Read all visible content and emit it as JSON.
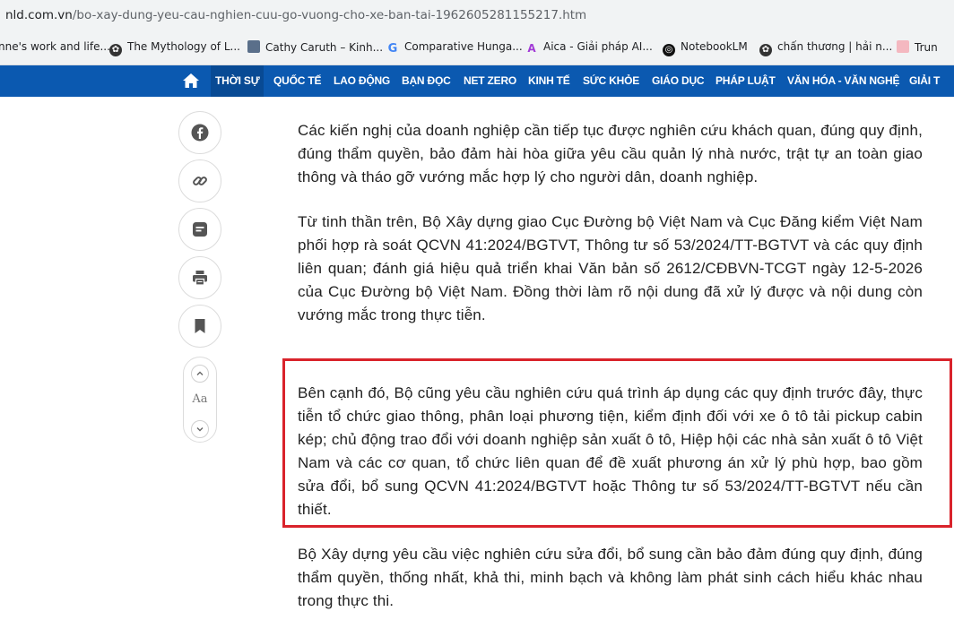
{
  "browser": {
    "url_host": "nld.com.vn",
    "url_path": "/bo-xay-dung-yeu-cau-nghien-cuu-go-vuong-cho-xe-ban-tai-196260528115521​7.htm",
    "bookmarks": [
      {
        "label": "nne's work and life...",
        "icon": "none"
      },
      {
        "label": "The Mythology of L...",
        "icon": "gear-icon"
      },
      {
        "label": "Cathy Caruth – Kinh...",
        "icon": "image-icon"
      },
      {
        "label": "Comparative Hunga...",
        "icon": "google-icon"
      },
      {
        "label": "Aica - Giải pháp AI...",
        "icon": "aica-icon"
      },
      {
        "label": "NotebookLM",
        "icon": "notebooklm-icon"
      },
      {
        "label": "chấn thương | hải n...",
        "icon": "gear-icon"
      },
      {
        "label": "Trun",
        "icon": "bookmark-icon"
      }
    ]
  },
  "nav": {
    "items": [
      "THỜI SỰ",
      "QUỐC TẾ",
      "LAO ĐỘNG",
      "BẠN ĐỌC",
      "NET ZERO",
      "KINH TẾ",
      "SỨC KHỎE",
      "GIÁO DỤC",
      "PHÁP LUẬT",
      "VĂN HÓA - VĂN NGHỆ",
      "GIẢI T"
    ],
    "active": "THỜI SỰ"
  },
  "sidebar": {
    "icons": [
      "facebook-icon",
      "link-icon",
      "comment-icon",
      "print-icon",
      "bookmark-icon"
    ],
    "font_label": "Aa"
  },
  "article": {
    "paragraphs": [
      "Các kiến nghị của doanh nghiệp cần tiếp tục được nghiên cứu khách quan, đúng quy định, đúng thẩm quyền, bảo đảm hài hòa giữa yêu cầu quản lý nhà nước, trật tự an toàn giao thông và tháo gỡ vướng mắc hợp lý cho người dân, doanh nghiệp.",
      "Từ tinh thần trên, Bộ Xây dựng giao Cục Đường bộ Việt Nam và Cục Đăng kiểm Việt Nam phối hợp rà soát QCVN 41:2024/BGTVT, Thông tư số 53/2024/TT-BGTVT và các quy định liên quan; đánh giá hiệu quả triển khai Văn bản số 2612/CĐBVN-TCGT ngày 12-5-2026 của Cục Đường bộ Việt Nam. Đồng thời làm rõ nội dung đã xử lý được và nội dung còn vướng mắc trong thực tiễn.",
      "Bên cạnh đó, Bộ cũng yêu cầu nghiên cứu quá trình áp dụng các quy định trước đây, thực tiễn tổ chức giao thông, phân loại phương tiện, kiểm định đối với xe ô tô tải pickup cabin kép; chủ động trao đổi với doanh nghiệp sản xuất ô tô, Hiệp hội các nhà sản xuất ô tô Việt Nam và các cơ quan, tổ chức liên quan để đề xuất phương án xử lý phù hợp, bao gồm sửa đổi, bổ sung QCVN 41:2024/BGTVT hoặc Thông tư số 53/2024/TT-BGTVT nếu cần thiết.",
      "Bộ Xây dựng yêu cầu việc nghiên cứu sửa đổi, bổ sung cần bảo đảm đúng quy định, đúng thẩm quyền, thống nhất, khả thi, minh bạch và không làm phát sinh cách hiểu khác nhau trong thực thi."
    ]
  },
  "colors": {
    "nav_bg": "#0b59b0",
    "nav_active_bg": "#084a94",
    "highlight_border": "#d9232b",
    "text": "#222222"
  }
}
